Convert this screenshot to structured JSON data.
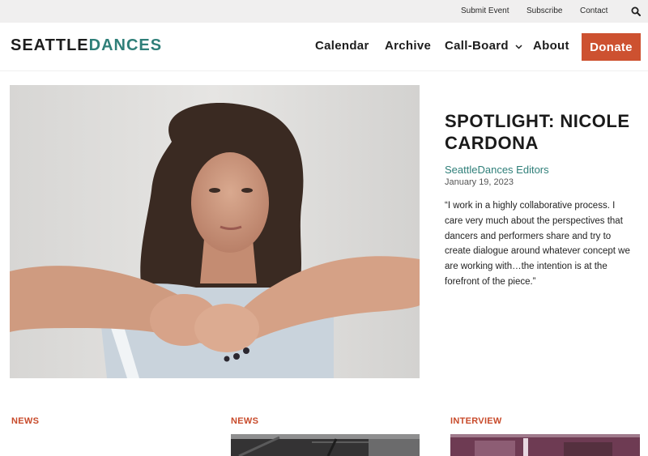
{
  "utility": {
    "links": [
      "Submit Event",
      "Subscribe",
      "Contact"
    ],
    "search_icon": "search-icon"
  },
  "header": {
    "logo_part1": "SEATTLE",
    "logo_part2": "DANCES",
    "nav": [
      "Calendar",
      "Archive",
      "Call-Board",
      "About"
    ],
    "donate_label": "Donate"
  },
  "feature": {
    "title": "SPOTLIGHT: NICOLE CARDONA",
    "author": "SeattleDances Editors",
    "date": "January 19, 2023",
    "quote": "“I work in a highly collaborative process. I care very much about the perspectives that dancers and performers share and try to create dialogue around whatever concept we are working with…the intention is at the forefront of the piece.”"
  },
  "cards": [
    {
      "tag": "NEWS"
    },
    {
      "tag": "NEWS"
    },
    {
      "tag": "INTERVIEW"
    }
  ],
  "colors": {
    "accent_teal": "#2f7f79",
    "donate_orange": "#cd5130",
    "tag_red": "#c84a2a"
  }
}
